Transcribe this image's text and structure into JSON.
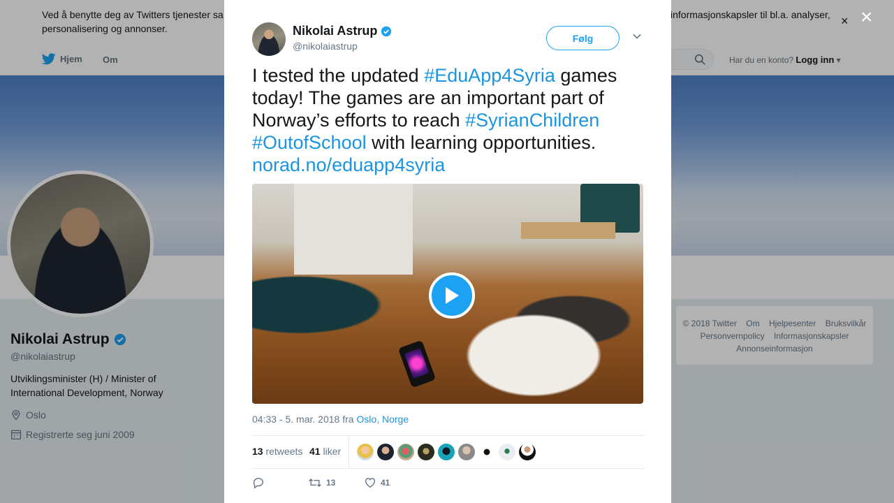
{
  "cookie_bar": {
    "text": "Ved å benytte deg av Twitters tjenester sa",
    "text2": "personalisering og annonser.",
    "text_right": "informasjonskapsler til bl.a. analyser,",
    "close": "×"
  },
  "nav": {
    "home": "Hjem",
    "about": "Om",
    "account_prompt": "Har du en konto?",
    "login": "Logg inn"
  },
  "profile": {
    "name": "Nikolai Astrup",
    "handle": "@nikolaiastrup",
    "bio": "Utviklingsminister (H) / Minister of International Development, Norway",
    "location": "Oslo",
    "joined": "Registrerte seg juni 2009"
  },
  "footer": {
    "links": [
      "© 2018 Twitter",
      "Om",
      "Hjelpesenter",
      "Bruksvilkår",
      "Personvernpolicy",
      "Informasjonskapsler",
      "Annonseinformasjon"
    ]
  },
  "overlay": {
    "close": "×"
  },
  "tweet": {
    "author_name": "Nikolai Astrup",
    "author_handle": "@nikolaiastrup",
    "follow_label": "Følg",
    "text_parts": {
      "p1": "I tested the updated ",
      "tag1": "#EduApp4Syria",
      "p2": " games today! The games are an important part of Norway’s efforts to reach ",
      "tag2": "#SyrianChildren",
      "tag3": "#OutofSchool",
      "p3": " with learning opportunities.",
      "link": "norad.no/eduapp4syria"
    },
    "timestamp": "04:33 - 5. mar. 2018 fra ",
    "location": "Oslo, Norge",
    "retweets_count": "13",
    "retweets_label": "retweets",
    "likes_count": "41",
    "likes_label": "liker",
    "action_retweets": "13",
    "action_likes": "41"
  },
  "colors": {
    "accent": "#1da1f2",
    "link": "#1b95e0",
    "muted": "#657786"
  }
}
